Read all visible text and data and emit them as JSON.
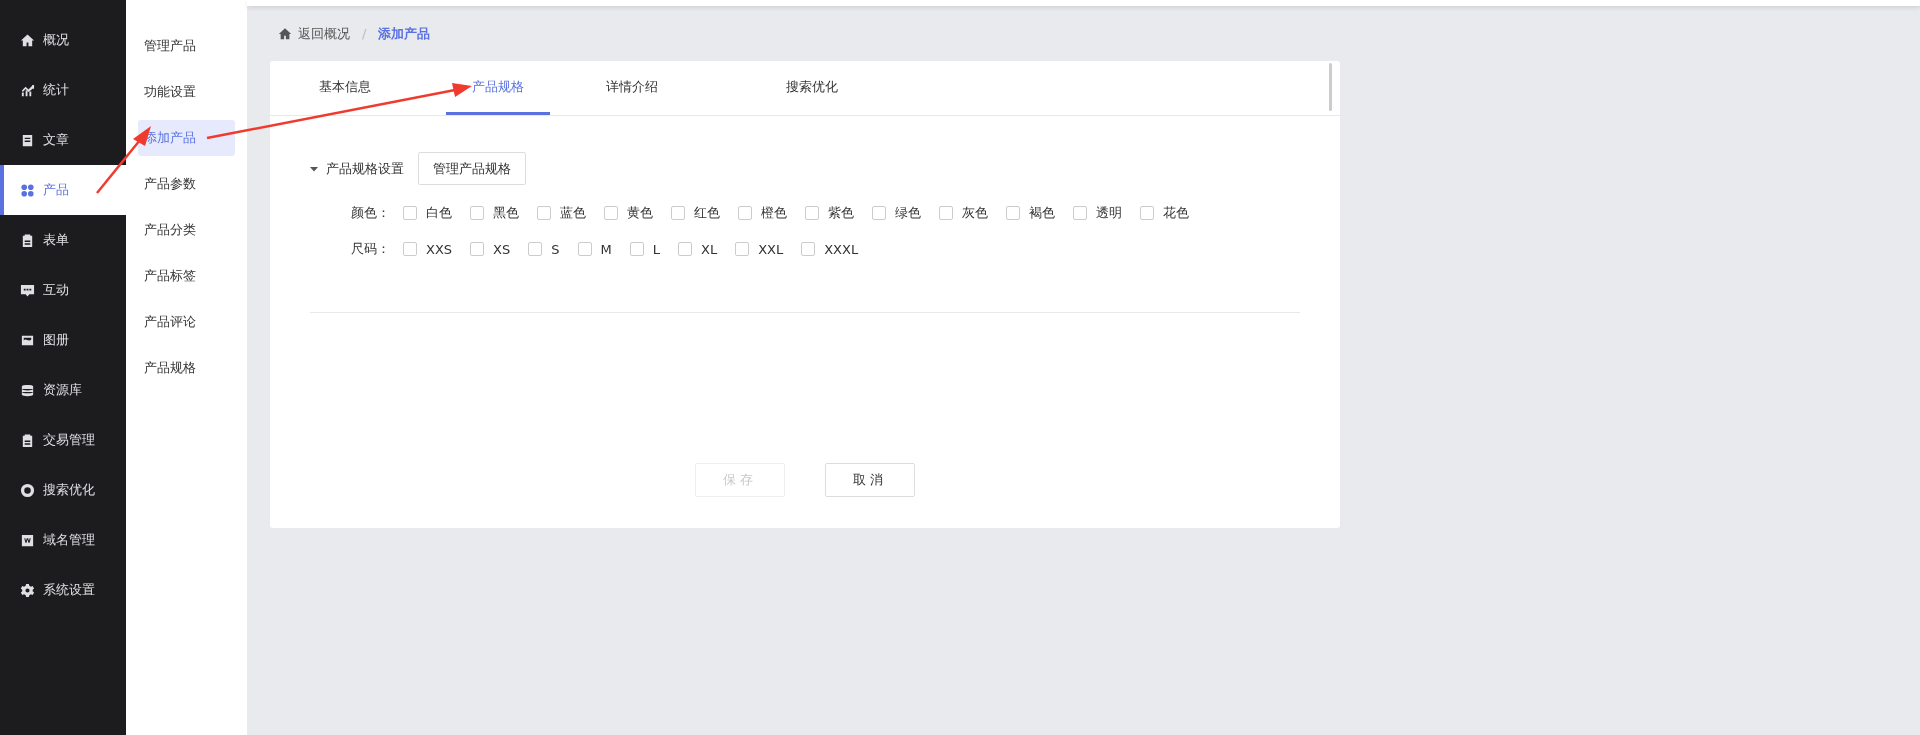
{
  "sidebar": {
    "items": [
      {
        "label": "概况",
        "selected": false
      },
      {
        "label": "统计",
        "selected": false
      },
      {
        "label": "文章",
        "selected": false
      },
      {
        "label": "产品",
        "selected": true
      },
      {
        "label": "表单",
        "selected": false
      },
      {
        "label": "互动",
        "selected": false
      },
      {
        "label": "图册",
        "selected": false
      },
      {
        "label": "资源库",
        "selected": false
      },
      {
        "label": "交易管理",
        "selected": false
      },
      {
        "label": "搜索优化",
        "selected": false
      },
      {
        "label": "域名管理",
        "selected": false
      },
      {
        "label": "系统设置",
        "selected": false
      }
    ]
  },
  "submenu": {
    "items": [
      {
        "label": "管理产品",
        "selected": false
      },
      {
        "label": "功能设置",
        "selected": false
      },
      {
        "label": "添加产品",
        "selected": true
      },
      {
        "label": "产品参数",
        "selected": false
      },
      {
        "label": "产品分类",
        "selected": false
      },
      {
        "label": "产品标签",
        "selected": false
      },
      {
        "label": "产品评论",
        "selected": false
      },
      {
        "label": "产品规格",
        "selected": false
      }
    ]
  },
  "breadcrumb": {
    "back": "返回概况",
    "separator": "/",
    "current": "添加产品"
  },
  "tabs": [
    {
      "label": "基本信息",
      "selected": false
    },
    {
      "label": "产品规格",
      "selected": true
    },
    {
      "label": "详情介绍",
      "selected": false
    },
    {
      "label": "搜索优化",
      "selected": false
    }
  ],
  "spec_section": {
    "title": "产品规格设置",
    "expanded": true,
    "manage_button": "管理产品规格",
    "groups": [
      {
        "label": "颜色：",
        "options": [
          {
            "label": "白色",
            "checked": false
          },
          {
            "label": "黑色",
            "checked": false
          },
          {
            "label": "蓝色",
            "checked": false
          },
          {
            "label": "黄色",
            "checked": false
          },
          {
            "label": "红色",
            "checked": false
          },
          {
            "label": "橙色",
            "checked": false
          },
          {
            "label": "紫色",
            "checked": false
          },
          {
            "label": "绿色",
            "checked": false
          },
          {
            "label": "灰色",
            "checked": false
          },
          {
            "label": "褐色",
            "checked": false
          },
          {
            "label": "透明",
            "checked": false
          },
          {
            "label": "花色",
            "checked": false
          }
        ]
      },
      {
        "label": "尺码：",
        "options": [
          {
            "label": "XXS",
            "checked": false
          },
          {
            "label": "XS",
            "checked": false
          },
          {
            "label": "S",
            "checked": false
          },
          {
            "label": "M",
            "checked": false
          },
          {
            "label": "L",
            "checked": false
          },
          {
            "label": "XL",
            "checked": false
          },
          {
            "label": "XXL",
            "checked": false
          },
          {
            "label": "XXXL",
            "checked": false
          }
        ]
      }
    ]
  },
  "buttons": [
    {
      "label": "保存",
      "disabled": true
    },
    {
      "label": "取消",
      "disabled": false
    }
  ]
}
